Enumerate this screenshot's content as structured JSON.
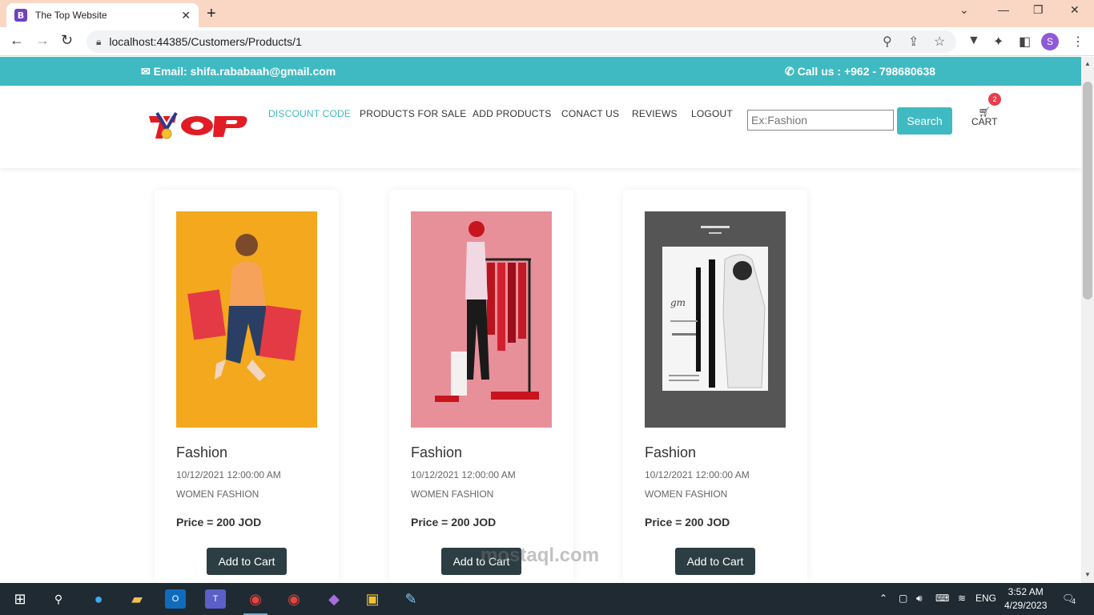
{
  "browser": {
    "tab_title": "The Top Website",
    "tab_favicon_letter": "B",
    "url": "localhost:44385/Customers/Products/1",
    "profile_initial": "S"
  },
  "topbar": {
    "email": "Email: shifa.rababaah@gmail.com",
    "phone": "Call us : +962 - 798680638"
  },
  "header": {
    "nav": [
      {
        "label": "DISCOUNT CODE"
      },
      {
        "label": "PRODUCTS FOR SALE"
      },
      {
        "label": "ADD PRODUCTS"
      },
      {
        "label": "CONACT US"
      },
      {
        "label": "REVIEWS"
      },
      {
        "label": "LOGOUT"
      }
    ],
    "search_placeholder": "Ex:Fashion",
    "search_label": "Search",
    "cart_label": "CART",
    "cart_count": "2"
  },
  "products": [
    {
      "title": "Fashion",
      "date": "10/12/2021 12:00:00 AM",
      "category": "WOMEN FASHION",
      "price": "Price = 200 JOD",
      "button": "Add to Cart"
    },
    {
      "title": "Fashion",
      "date": "10/12/2021 12:00:00 AM",
      "category": "WOMEN FASHION",
      "price": "Price = 200 JOD",
      "button": "Add to Cart"
    },
    {
      "title": "Fashion",
      "date": "10/12/2021 12:00:00 AM",
      "category": "WOMEN FASHION",
      "price": "Price = 200 JOD",
      "button": "Add to Cart"
    }
  ],
  "watermark": "mostaql.com",
  "taskbar": {
    "language": "ENG",
    "time": "3:52 AM",
    "date": "4/29/2023",
    "notifications": "4"
  },
  "colors": {
    "accent": "#40bac2",
    "button_dark": "#2c3e44",
    "tab_bar": "#f9d7c4",
    "logo_red": "#e11c24"
  }
}
